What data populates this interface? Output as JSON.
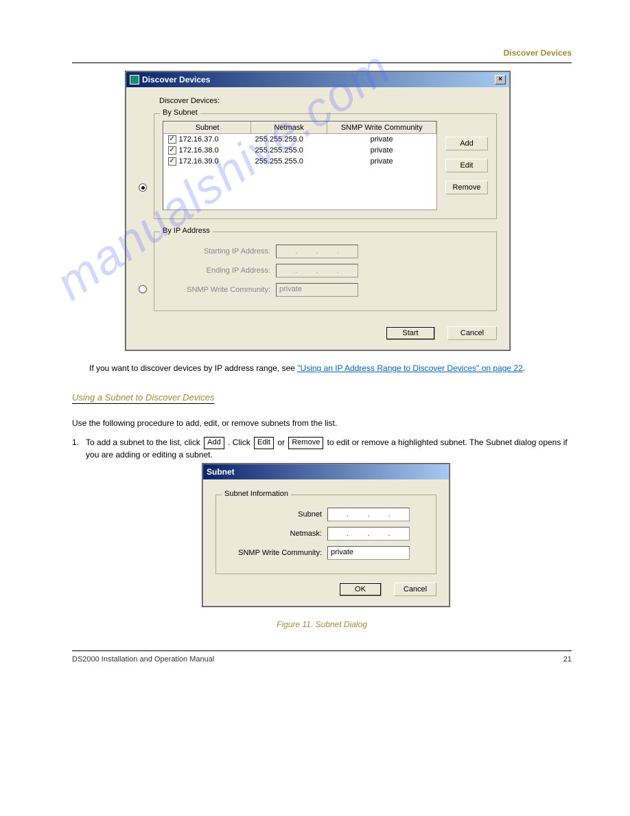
{
  "header": {
    "right": "Discover Devices"
  },
  "discover_dialog": {
    "title": "Discover Devices",
    "heading": "Discover Devices:",
    "by_subnet_legend": "By Subnet",
    "columns": {
      "subnet": "Subnet",
      "netmask": "Netmask",
      "snmp": "SNMP Write Community"
    },
    "rows": [
      {
        "subnet": "172.16.37.0",
        "netmask": "255.255.255.0",
        "snmp": "private",
        "checked": true
      },
      {
        "subnet": "172.16.38.0",
        "netmask": "255.255.255.0",
        "snmp": "private",
        "checked": true
      },
      {
        "subnet": "172.16.39.0",
        "netmask": "255.255.255.0",
        "snmp": "private",
        "checked": true
      }
    ],
    "buttons": {
      "add": "Add",
      "edit": "Edit",
      "remove": "Remove"
    },
    "by_ip_legend": "By IP Address",
    "ip_labels": {
      "start": "Starting IP Address:",
      "end": "Ending IP Address:",
      "snmp": "SNMP Write Community:"
    },
    "snmp_value": "private",
    "actions": {
      "start": "Start",
      "cancel": "Cancel"
    }
  },
  "body": {
    "para1_a": "If you want to discover devices by IP address range, see ",
    "para1_link": "\"Using an IP Address Range to Discover Devices\" on page 22",
    "para1_b": ".",
    "section_head": "Using a Subnet to Discover Devices",
    "para2_a": "Use the following procedure to add, edit, or remove subnets from the list.",
    "step1": "1.",
    "step1_a": "To add a subnet to the list, click ",
    "step1_btn": "Add",
    "step1_b": ". Click ",
    "step1_btn2": "Edit",
    "step1_c": " or ",
    "step1_btn3": "Remove",
    "step1_d": " to edit or remove a highlighted subnet. The Subnet dialog opens if you are adding or editing a subnet.",
    "figure_caption": "Figure 11. Subnet Dialog"
  },
  "subnet_dialog": {
    "title": "Subnet",
    "fieldset_legend": "Subnet Information",
    "labels": {
      "subnet": "Subnet",
      "netmask": "Netmask:",
      "snmp": "SNMP Write Community:"
    },
    "snmp_value": "private",
    "actions": {
      "ok": "OK",
      "cancel": "Cancel"
    }
  },
  "footer": {
    "left": "DS2000 Installation and Operation Manual",
    "right": "21"
  },
  "watermark": "manualshive.com"
}
